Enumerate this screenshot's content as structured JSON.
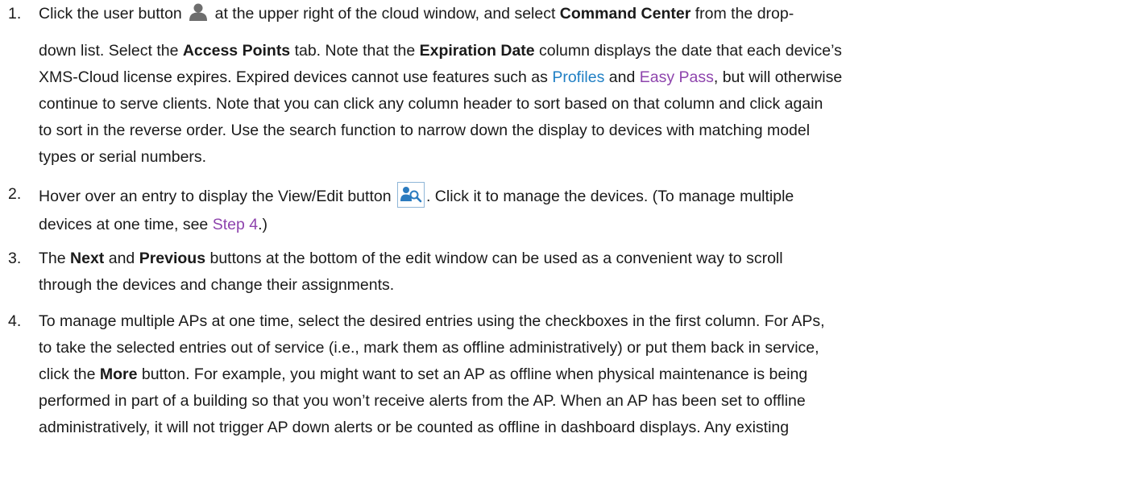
{
  "steps": [
    {
      "num": "1.",
      "lines": [
        [
          "Click the user button ",
          "{user-icon}",
          " at the upper right of the cloud window, and select ",
          "**Command Center",
          " from the drop-"
        ],
        [
          "down list. Select the ",
          "**Access Points",
          " tab. Note that the ",
          "**Expiration Date",
          " column displays the date that each device’s"
        ],
        [
          "XMS-Cloud license expires. Expired devices cannot use features such as ",
          "~blue:Profiles",
          " and ",
          "~purple:Easy Pass",
          ", but will otherwise"
        ],
        [
          "continue to serve clients. Note that you can click any column header to sort based on that column and click again"
        ],
        [
          "to sort in the reverse order. Use the search function to narrow down the display to devices with matching model"
        ],
        [
          "types or serial numbers."
        ]
      ]
    },
    {
      "num": "2.",
      "lines": [
        [
          "Hover over an entry to display the View/Edit button ",
          "{viewedit-icon}",
          ". Click it to manage the devices. (To manage multiple"
        ],
        [
          "devices at one time, see ",
          "~purple:Step 4",
          ".)"
        ]
      ]
    },
    {
      "num": "3.",
      "lines": [
        [
          "The ",
          "**Next",
          " and ",
          "**Previous",
          " buttons at the bottom of the edit window can be used as a convenient way to scroll"
        ],
        [
          "through the devices and change their assignments."
        ]
      ]
    },
    {
      "num": "4.",
      "lines": [
        [
          "To manage multiple APs at one time, select the desired entries using the checkboxes in the first column. For APs,"
        ],
        [
          "to take the selected entries out of service (i.e., mark them as offline administratively) or put them back in service,"
        ],
        [
          "click the ",
          "**More",
          " button. For example, you might want to set an AP as offline when physical maintenance is being"
        ],
        [
          "performed in part of a building so that you won’t receive alerts from the AP. When an AP has been set to offline"
        ],
        [
          "administratively, it will not trigger AP down alerts or be counted as offline in dashboard displays. Any existing"
        ]
      ]
    }
  ],
  "colors": {
    "link_blue": "#1f7fc4",
    "link_purple": "#8e44ad",
    "icon_gray": "#6e6e6e",
    "icon_blue": "#2b7bbf"
  }
}
